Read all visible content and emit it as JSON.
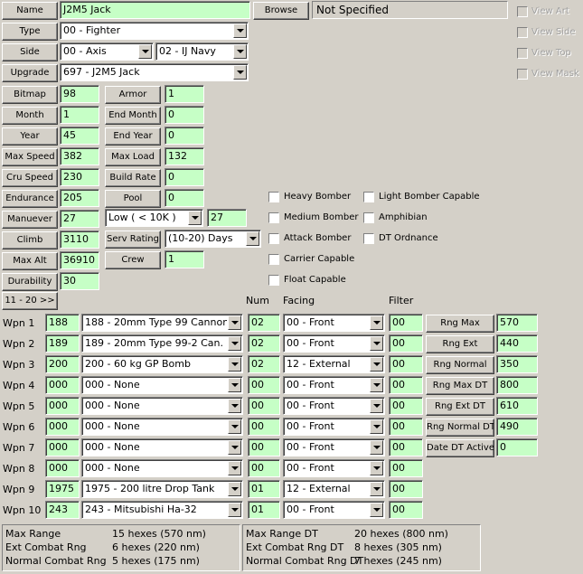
{
  "top": {
    "name_button": "Name",
    "name_value": "J2M5 Jack",
    "browse_button": "Browse",
    "art_box": "Not Specified",
    "type_button": "Type",
    "type_value": "00 - Fighter",
    "side_button": "Side",
    "side_value": "00 - Axis",
    "nation_value": "02 - IJ Navy",
    "upgrade_button": "Upgrade",
    "upgrade_value": "697 - J2M5 Jack"
  },
  "view_checks": [
    "View Art",
    "View Side",
    "View Top",
    "View Mask"
  ],
  "left_fields": [
    {
      "label": "Bitmap",
      "value": "98"
    },
    {
      "label": "Month",
      "value": "1"
    },
    {
      "label": "Year",
      "value": "45"
    },
    {
      "label": "Max Speed",
      "value": "382"
    },
    {
      "label": "Cru Speed",
      "value": "230"
    },
    {
      "label": "Endurance",
      "value": "205"
    },
    {
      "label": "Manuever",
      "value": "27"
    },
    {
      "label": "Climb",
      "value": "3110"
    },
    {
      "label": "Max Alt",
      "value": "36910"
    },
    {
      "label": "Durability",
      "value": "30"
    }
  ],
  "mid_fields": [
    {
      "label": "Armor",
      "value": "1"
    },
    {
      "label": "End Month",
      "value": "0"
    },
    {
      "label": "End Year",
      "value": "0"
    },
    {
      "label": "Max Load",
      "value": "132"
    },
    {
      "label": "Build Rate",
      "value": "0"
    },
    {
      "label": "Pool",
      "value": "0"
    }
  ],
  "maneuver_alt": {
    "value": "Low    ( < 10K )",
    "number": "27"
  },
  "serv": {
    "button": "Serv Rating",
    "value": "(10-20) Days"
  },
  "crew": {
    "button": "Crew",
    "value": "1"
  },
  "checks_col1": [
    "Heavy Bomber",
    "Medium Bomber",
    "Attack Bomber",
    "Carrier Capable",
    "Float Capable"
  ],
  "checks_col2": [
    "Light Bomber Capable",
    "Amphibian",
    "DT Ordnance"
  ],
  "page_button": "11 - 20 >>",
  "weapon_headers": {
    "num": "Num",
    "facing": "Facing",
    "filter": "Filter"
  },
  "weapons": [
    {
      "label": "Wpn 1",
      "id": "188",
      "name": "188 - 20mm Type 99 Cannon",
      "num": "02",
      "facing": "00 - Front",
      "filter": "00"
    },
    {
      "label": "Wpn 2",
      "id": "189",
      "name": "189 - 20mm Type 99-2 Can.",
      "num": "02",
      "facing": "00 - Front",
      "filter": "00"
    },
    {
      "label": "Wpn 3",
      "id": "200",
      "name": "200 - 60 kg GP Bomb",
      "num": "02",
      "facing": "12 - External",
      "filter": "00"
    },
    {
      "label": "Wpn 4",
      "id": "000",
      "name": "000 - None",
      "num": "00",
      "facing": "00 - Front",
      "filter": "00"
    },
    {
      "label": "Wpn 5",
      "id": "000",
      "name": "000 - None",
      "num": "00",
      "facing": "00 - Front",
      "filter": "00"
    },
    {
      "label": "Wpn 6",
      "id": "000",
      "name": "000 - None",
      "num": "00",
      "facing": "00 - Front",
      "filter": "00"
    },
    {
      "label": "Wpn 7",
      "id": "000",
      "name": "000 - None",
      "num": "00",
      "facing": "00 - Front",
      "filter": "00"
    },
    {
      "label": "Wpn 8",
      "id": "000",
      "name": "000 - None",
      "num": "00",
      "facing": "00 - Front",
      "filter": "00"
    },
    {
      "label": "Wpn 9",
      "id": "1975",
      "name": "1975 - 200 litre Drop Tank",
      "num": "01",
      "facing": "12 - External",
      "filter": "00"
    },
    {
      "label": "Wpn 10",
      "id": "243",
      "name": "243 - Mitsubishi Ha-32",
      "num": "01",
      "facing": "00 - Front",
      "filter": "00"
    }
  ],
  "ranges": [
    {
      "label": "Rng Max",
      "value": "570"
    },
    {
      "label": "Rng Ext",
      "value": "440"
    },
    {
      "label": "Rng Normal",
      "value": "350"
    },
    {
      "label": "Rng Max DT",
      "value": "800"
    },
    {
      "label": "Rng Ext DT",
      "value": "610"
    },
    {
      "label": "Rng Normal DT",
      "value": "490"
    },
    {
      "label": "Date DT Active",
      "value": "0"
    }
  ],
  "summary_left": [
    {
      "label": "Max Range",
      "value": "15 hexes (570 nm)"
    },
    {
      "label": "Ext Combat Rng",
      "value": "6 hexes (220 nm)"
    },
    {
      "label": "Normal Combat Rng",
      "value": "5 hexes (175 nm)"
    }
  ],
  "summary_right": [
    {
      "label": "Max Range DT",
      "value": "20 hexes (800 nm)"
    },
    {
      "label": "Ext Combat Rng DT",
      "value": "8 hexes (305 nm)"
    },
    {
      "label": "Normal Combat Rng DT",
      "value": "7 hexes (245 nm)"
    }
  ]
}
